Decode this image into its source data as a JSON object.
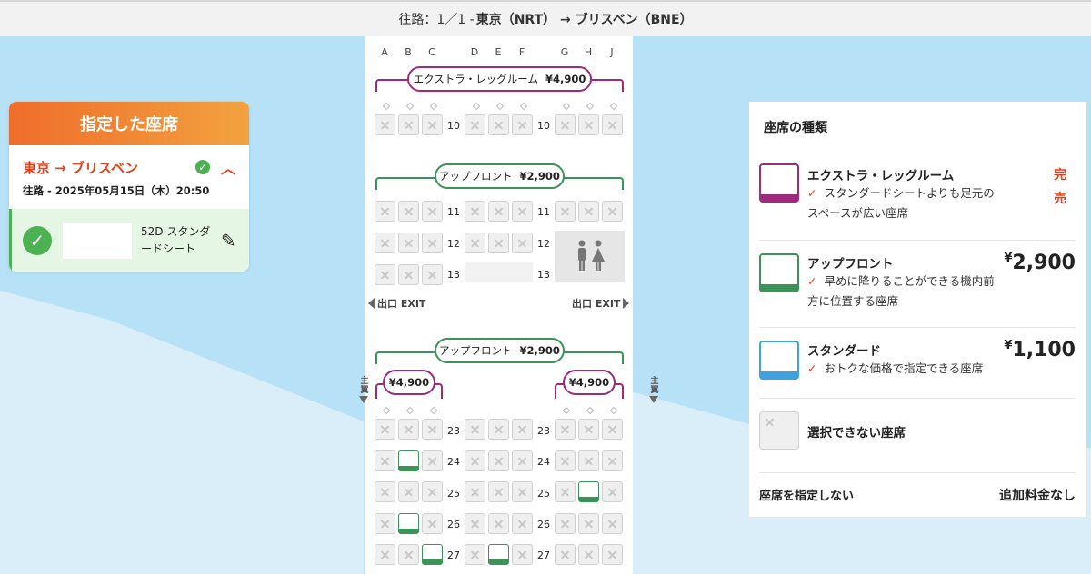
{
  "header": {
    "prefix": "往路：1／1 -",
    "route": "東京（NRT） → ブリスベン（BNE）"
  },
  "selected": {
    "title": "指定した座席",
    "route": "東京 → ブリスベン",
    "date": "往路 - 2025年05月15日（木）20:50",
    "seat_label": "52D スタンダードシート"
  },
  "seatmap": {
    "columns": [
      "A",
      "B",
      "C",
      "D",
      "E",
      "F",
      "G",
      "H",
      "J"
    ],
    "extra_legroom_pill": "エクストラ・レッグルーム",
    "extra_legroom_price": "¥4,900",
    "upfront_pill": "アップフロント",
    "upfront_price": "¥2,900",
    "upfront_pill_2": "アップフロント",
    "upfront_price_2": "¥2,900",
    "wing_price_left": "¥4,900",
    "wing_price_right": "¥4,900",
    "exit_left": "出口 EXIT",
    "exit_right": "出口 EXIT",
    "wing_label": "主翼",
    "rows": [
      "10",
      "11",
      "12",
      "13",
      "23",
      "24",
      "25",
      "26",
      "27"
    ]
  },
  "legend": {
    "title": "座席の種類",
    "items": [
      {
        "name": "エクストラ・レッグルーム",
        "desc": "スタンダードシートよりも足元のスペースが広い座席",
        "status": "完売",
        "color": "#9e2a7e"
      },
      {
        "name": "アップフロント",
        "desc": "早めに降りることができる機内前方に位置する座席",
        "price": "2,900",
        "color": "#3b9358"
      },
      {
        "name": "スタンダード",
        "desc": "おトクな価格で指定できる座席",
        "price": "1,100",
        "color": "#3fa2dc"
      },
      {
        "name": "選択できない座席"
      }
    ],
    "currency": "¥",
    "no_seat_label": "座席を指定しない",
    "no_seat_value": "追加料金なし"
  }
}
